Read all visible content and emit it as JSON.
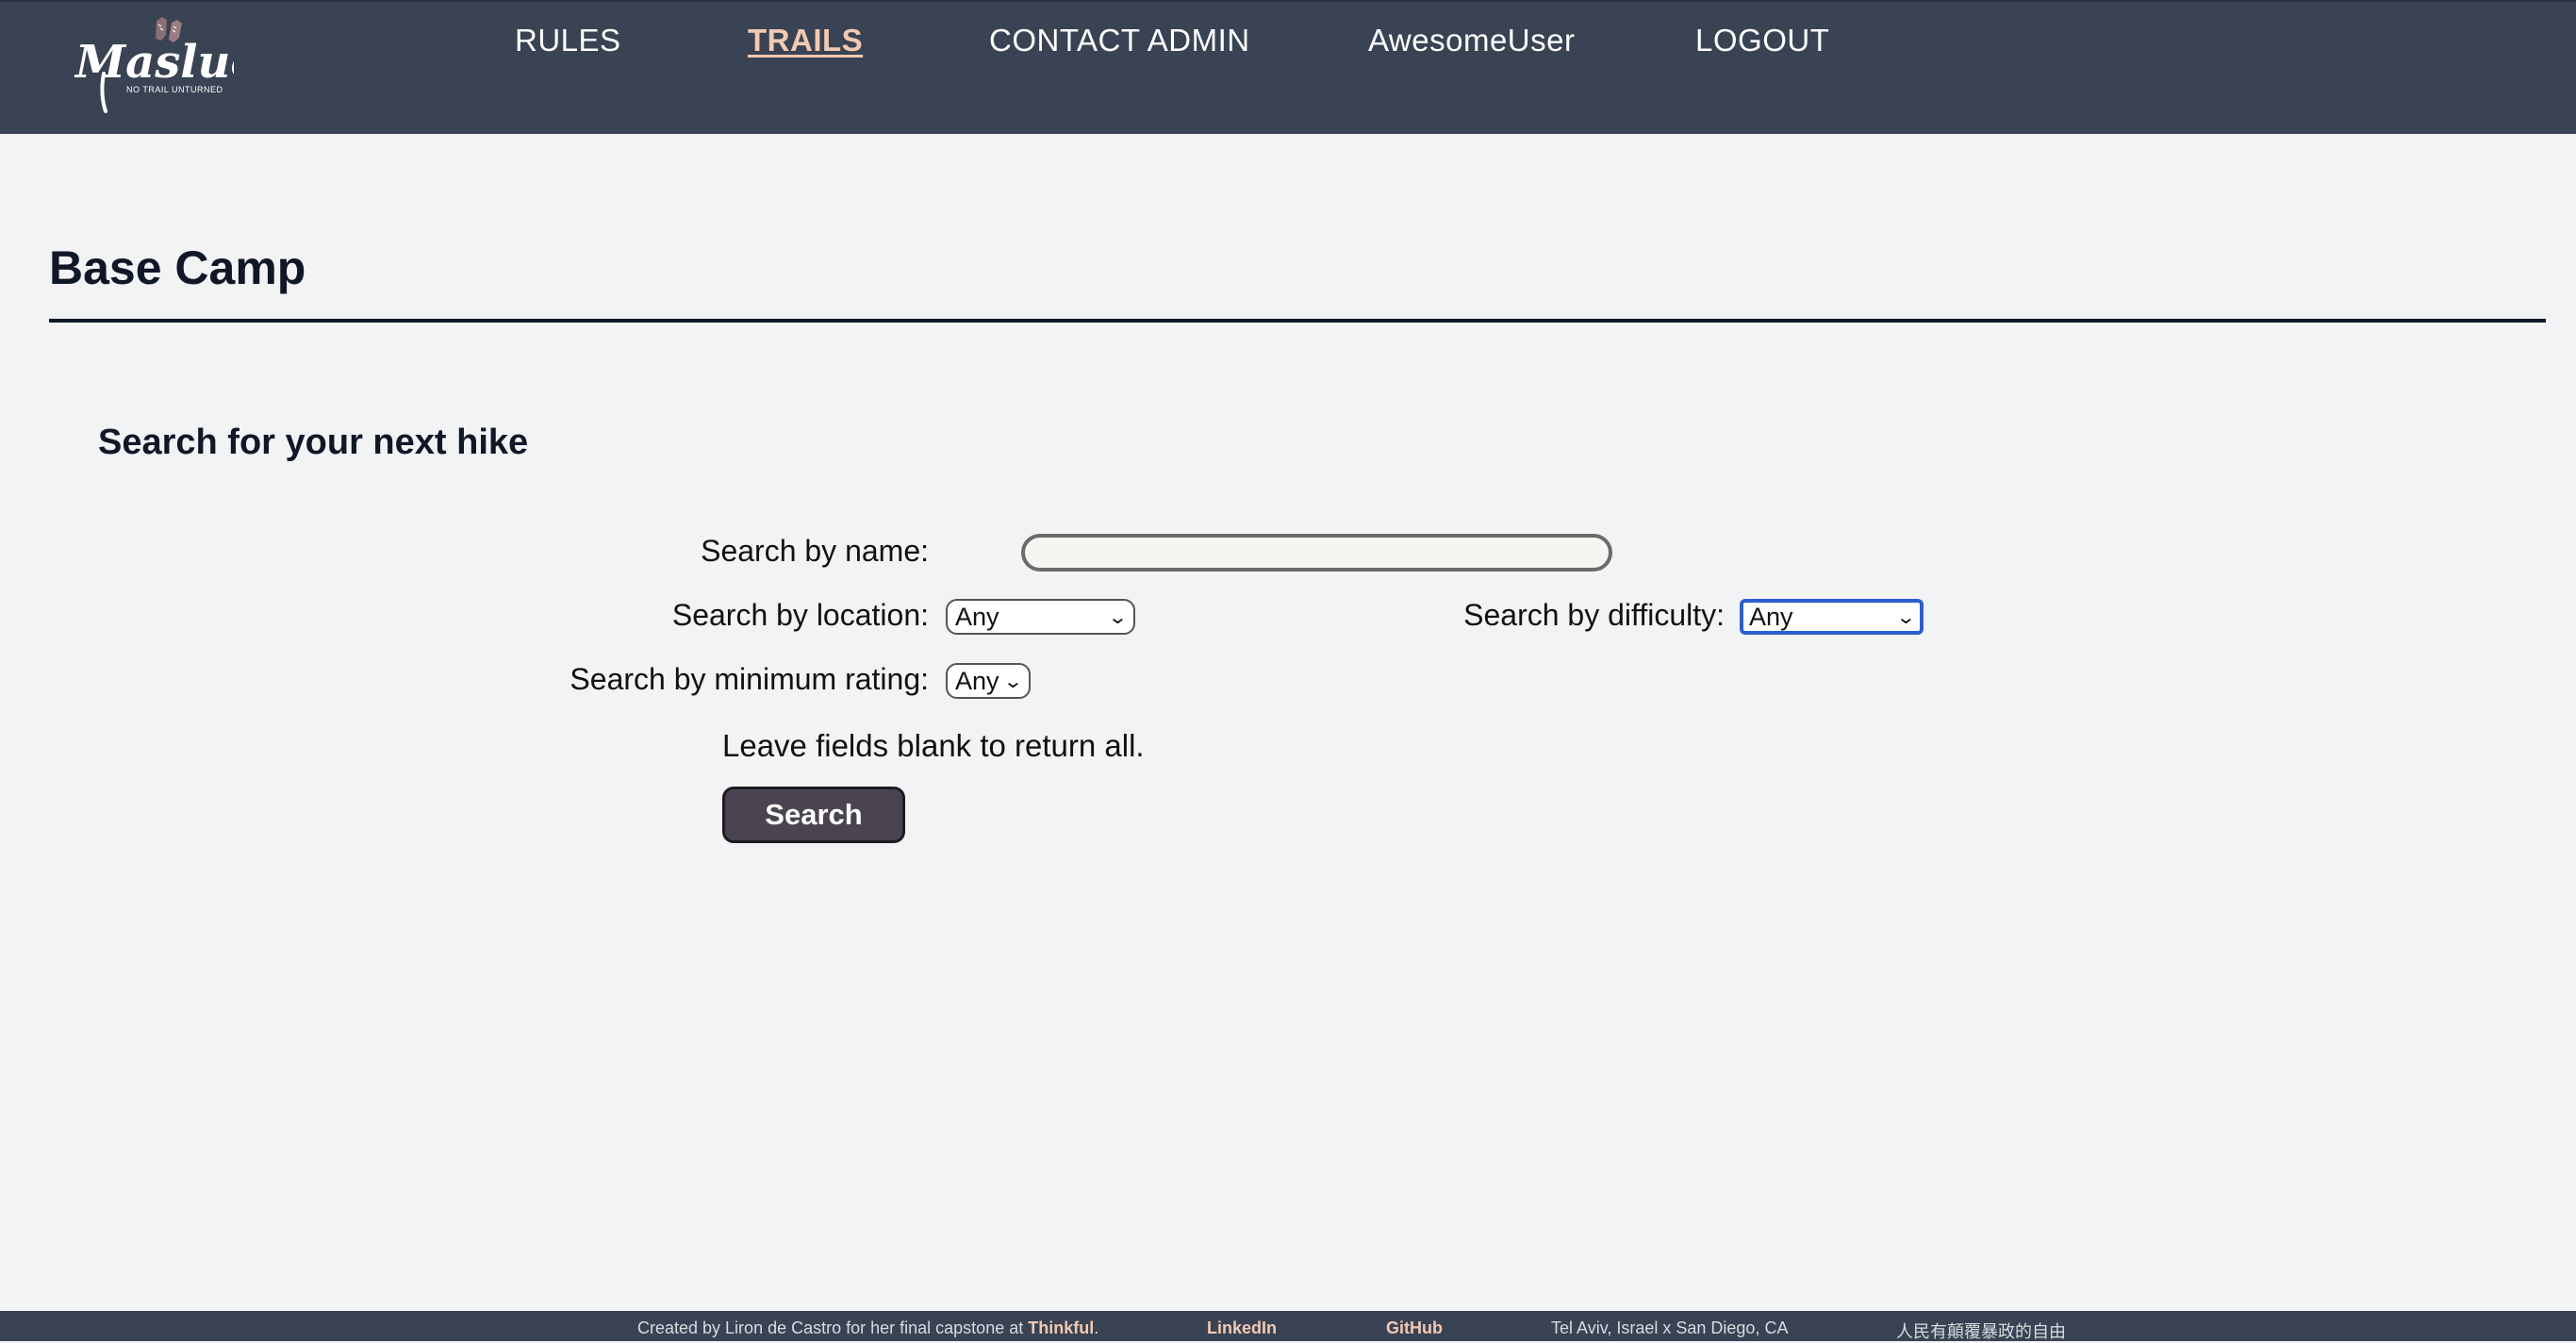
{
  "header": {
    "logo": {
      "wordmark": "Masluol",
      "tagline": "NO TRAIL UNTURNED"
    },
    "nav": [
      {
        "label": "RULES",
        "active": false
      },
      {
        "label": "TRAILS",
        "active": true
      },
      {
        "label": "CONTACT ADMIN",
        "active": false
      },
      {
        "label": "AwesomeUser",
        "active": false
      },
      {
        "label": "LOGOUT",
        "active": false
      }
    ]
  },
  "main": {
    "page_title": "Base Camp",
    "section_title": "Search for your next hike",
    "form": {
      "name_label": "Search by name:",
      "name_value": "",
      "location_label": "Search by location:",
      "location_value": "Any",
      "difficulty_label": "Search by difficulty:",
      "difficulty_value": "Any",
      "rating_label": "Search by minimum rating:",
      "rating_value": "Any",
      "hint": "Leave fields blank to return all.",
      "submit_label": "Search"
    }
  },
  "footer": {
    "credit_prefix": "Created by Liron de Castro for her final capstone at ",
    "credit_link": "Thinkful",
    "credit_suffix": ".",
    "linkedin": "LinkedIn",
    "github": "GitHub",
    "location": "Tel Aviv, Israel x San Diego, CA",
    "slogan": "人民有顛覆暴政的自由"
  },
  "colors": {
    "header_bg": "#394353",
    "page_bg": "#f2f3f4",
    "active_link": "#f2c9b3",
    "button_bg": "#4a4450",
    "focus_ring": "#2b5fd0"
  },
  "icons": {
    "logo": "boots-logo",
    "select_arrow": "chevron-down-icon"
  }
}
